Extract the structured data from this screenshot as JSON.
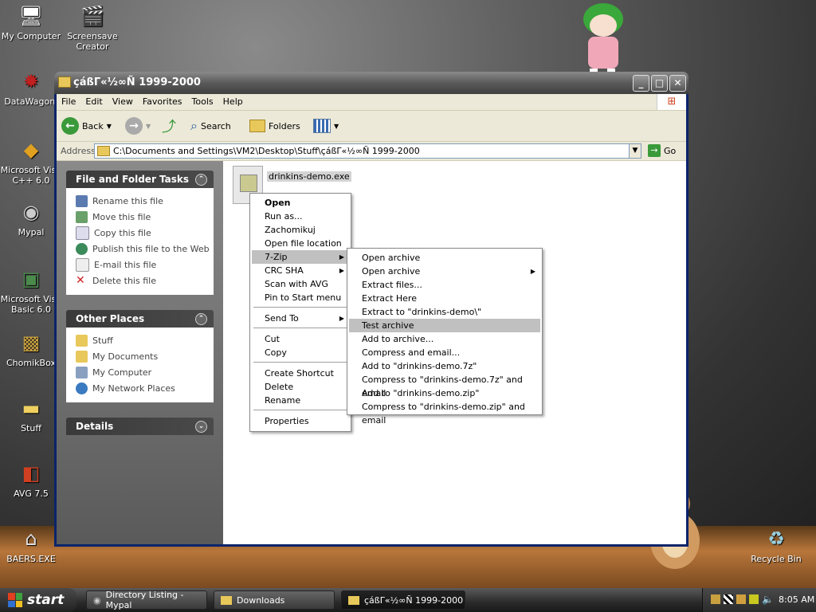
{
  "desktop": {
    "icons": [
      {
        "label": "My Computer",
        "icon": "computer-icon"
      },
      {
        "label": "Screensave Creator",
        "icon": "clapperboard-icon"
      },
      {
        "label": "DataWagon.",
        "icon": "datawagon-icon"
      },
      {
        "label": "Microsoft Visu C++ 6.0",
        "icon": "visual-cpp-icon"
      },
      {
        "label": "Mypal",
        "icon": "raccoon-icon"
      },
      {
        "label": "Microsoft Visu Basic 6.0",
        "icon": "visual-basic-icon"
      },
      {
        "label": "ChomikBox",
        "icon": "chomikbox-icon"
      },
      {
        "label": "Stuff",
        "icon": "folder-icon"
      },
      {
        "label": "AVG 7.5",
        "icon": "avg-icon"
      },
      {
        "label": "BAERS.EXE",
        "icon": "baers-icon"
      },
      {
        "label": "Recycle Bin",
        "icon": "recycle-bin-icon"
      }
    ]
  },
  "window": {
    "title": "çáßΓ«½∞Ñ 1999-2000",
    "controls": {
      "minimize": "_",
      "maximize": "□",
      "close": "✕"
    },
    "menu": [
      "File",
      "Edit",
      "View",
      "Favorites",
      "Tools",
      "Help"
    ],
    "toolbar": {
      "back": "Back",
      "search": "Search",
      "folders": "Folders"
    },
    "address": {
      "label": "Address",
      "value": "C:\\Documents and Settings\\VM2\\Desktop\\Stuff\\çáßΓ«½∞Ñ 1999-2000",
      "go": "Go"
    }
  },
  "tasks": {
    "file_folder": {
      "title": "File and Folder Tasks",
      "items": [
        "Rename this file",
        "Move this file",
        "Copy this file",
        "Publish this file to the Web",
        "E-mail this file",
        "Delete this file"
      ]
    },
    "other_places": {
      "title": "Other Places",
      "items": [
        "Stuff",
        "My Documents",
        "My Computer",
        "My Network Places"
      ]
    },
    "details": {
      "title": "Details"
    }
  },
  "file": {
    "name": "drinkins-demo.exe"
  },
  "context_menu": {
    "items": [
      "Open",
      "Run as...",
      "Zachomikuj",
      "Open file location",
      "7-Zip",
      "CRC SHA",
      "Scan with AVG",
      "Pin to Start menu",
      "Send To",
      "Cut",
      "Copy",
      "Create Shortcut",
      "Delete",
      "Rename",
      "Properties"
    ],
    "selected": "7-Zip"
  },
  "submenu_7zip": {
    "items": [
      "Open archive",
      "Open archive",
      "Extract files...",
      "Extract Here",
      "Extract to \"drinkins-demo\\\"",
      "Test archive",
      "Add to archive...",
      "Compress and email...",
      "Add to \"drinkins-demo.7z\"",
      "Compress to \"drinkins-demo.7z\" and email",
      "Add to \"drinkins-demo.zip\"",
      "Compress to \"drinkins-demo.zip\" and email"
    ],
    "selected": "Test archive"
  },
  "taskbar": {
    "start": "start",
    "tasks": [
      "Directory Listing - Mypal",
      "Downloads",
      "çáßΓ«½∞Ñ 1999-2000"
    ],
    "active": "çáßΓ«½∞Ñ 1999-2000",
    "clock": "8:05 AM"
  },
  "colors": {
    "selection": "#c0c0c0",
    "window_frame": "#5a5a5a",
    "go_green": "#3a9a3a"
  }
}
